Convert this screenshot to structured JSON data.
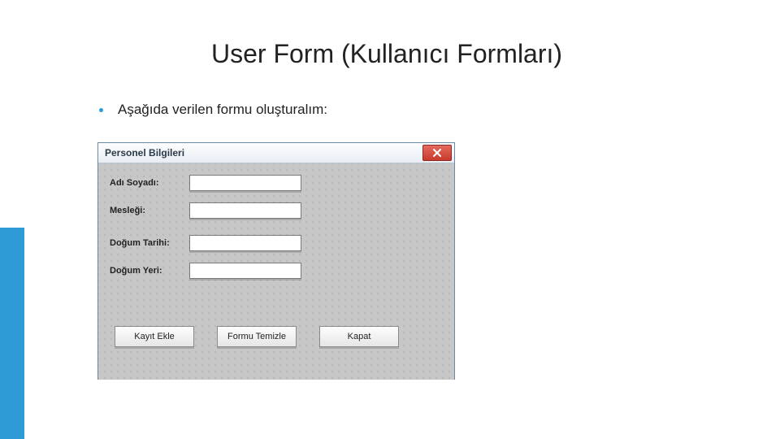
{
  "slide": {
    "title": "User Form (Kullanıcı Formları)",
    "bullet": "Aşağıda verilen formu oluşturalım:"
  },
  "form": {
    "title": "Personel Bilgileri",
    "close_icon": "close-icon",
    "labels": {
      "ad_soyad": "Adı Soyadı:",
      "meslek": "Mesleği:",
      "dogum_tarihi": "Doğum Tarihi:",
      "dogum_yeri": "Doğum Yeri:"
    },
    "inputs": {
      "ad_soyad": "",
      "meslek": "",
      "dogum_tarihi": "",
      "dogum_yeri": ""
    },
    "buttons": {
      "kayit": "Kayıt Ekle",
      "temizle": "Formu Temizle",
      "kapat": "Kapat"
    }
  },
  "colors": {
    "accent": "#2e9bd6"
  }
}
